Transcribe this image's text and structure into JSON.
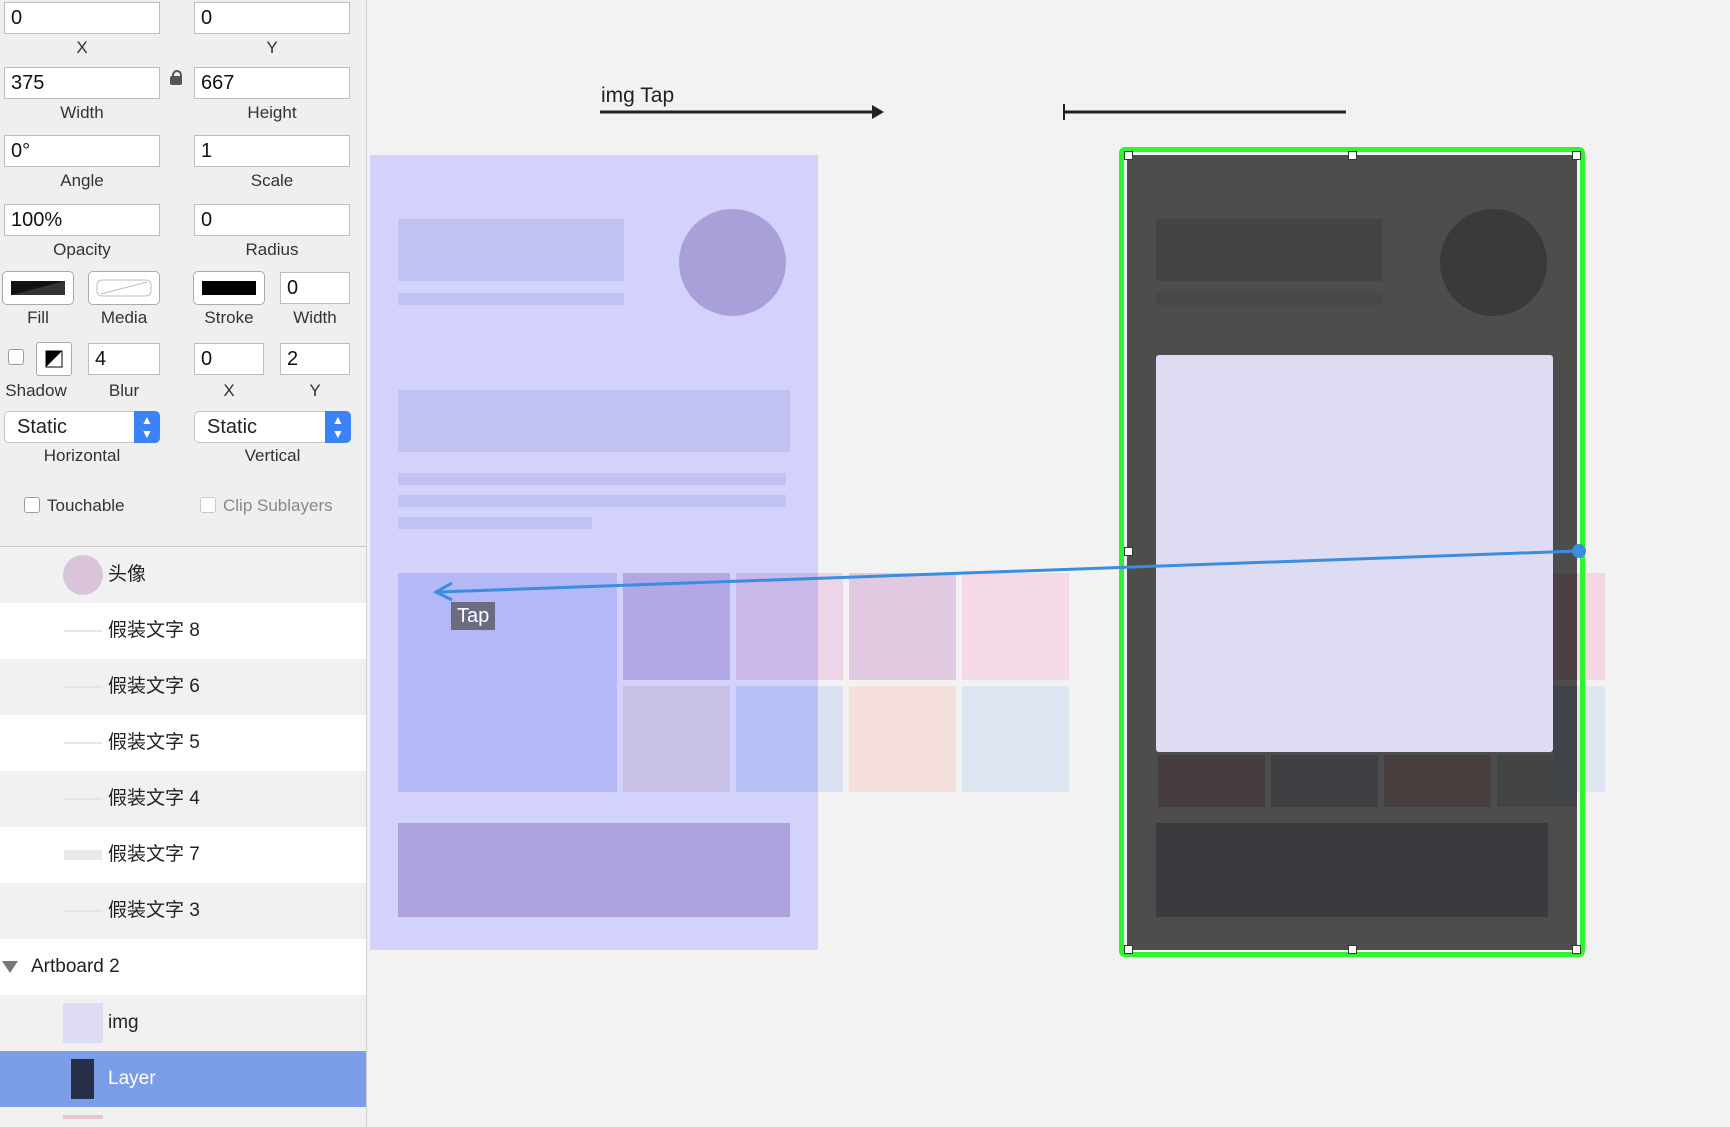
{
  "inspector": {
    "x": {
      "value": "0",
      "caption": "X"
    },
    "y": {
      "value": "0",
      "caption": "Y"
    },
    "width": {
      "value": "375",
      "caption": "Width"
    },
    "height": {
      "value": "667",
      "caption": "Height"
    },
    "angle": {
      "value": "0°",
      "caption": "Angle"
    },
    "scale": {
      "value": "1",
      "caption": "Scale"
    },
    "opacity": {
      "value": "100%",
      "caption": "Opacity"
    },
    "radius": {
      "value": "0",
      "caption": "Radius"
    },
    "fill_caption": "Fill",
    "media_caption": "Media",
    "stroke_caption": "Stroke",
    "stroke_width": {
      "value": "0",
      "caption": "Width"
    },
    "shadow_caption": "Shadow",
    "blur": {
      "value": "4",
      "caption": "Blur"
    },
    "shadow_x": {
      "value": "0",
      "caption": "X"
    },
    "shadow_y": {
      "value": "2",
      "caption": "Y"
    },
    "horizontal": {
      "value": "Static",
      "caption": "Horizontal"
    },
    "vertical": {
      "value": "Static",
      "caption": "Vertical"
    },
    "touchable": "Touchable",
    "clip_sublayers": "Clip Sublayers"
  },
  "layers": [
    {
      "label": "头像",
      "thumb": "circle"
    },
    {
      "label": "假装文字 8",
      "thumb": "line"
    },
    {
      "label": "假装文字 6",
      "thumb": "line"
    },
    {
      "label": "假装文字 5",
      "thumb": "line"
    },
    {
      "label": "假装文字 4",
      "thumb": "line"
    },
    {
      "label": "假装文字 7",
      "thumb": "thick"
    },
    {
      "label": "假装文字 3",
      "thumb": "line"
    },
    {
      "label": "Artboard 2",
      "thumb": "disclosure"
    },
    {
      "label": "img",
      "thumb": "square"
    },
    {
      "label": "Layer",
      "thumb": "dark",
      "selected": true
    }
  ],
  "canvas": {
    "transition_label": "img Tap",
    "tap_label": "Tap"
  },
  "colors": {
    "selection": "#2ef52e",
    "link": "#3b8de0",
    "artboard1_bg": "#d3d2fc",
    "artboard2_bg": "#4d4d4d",
    "layer_selected": "#7b9ee6"
  }
}
